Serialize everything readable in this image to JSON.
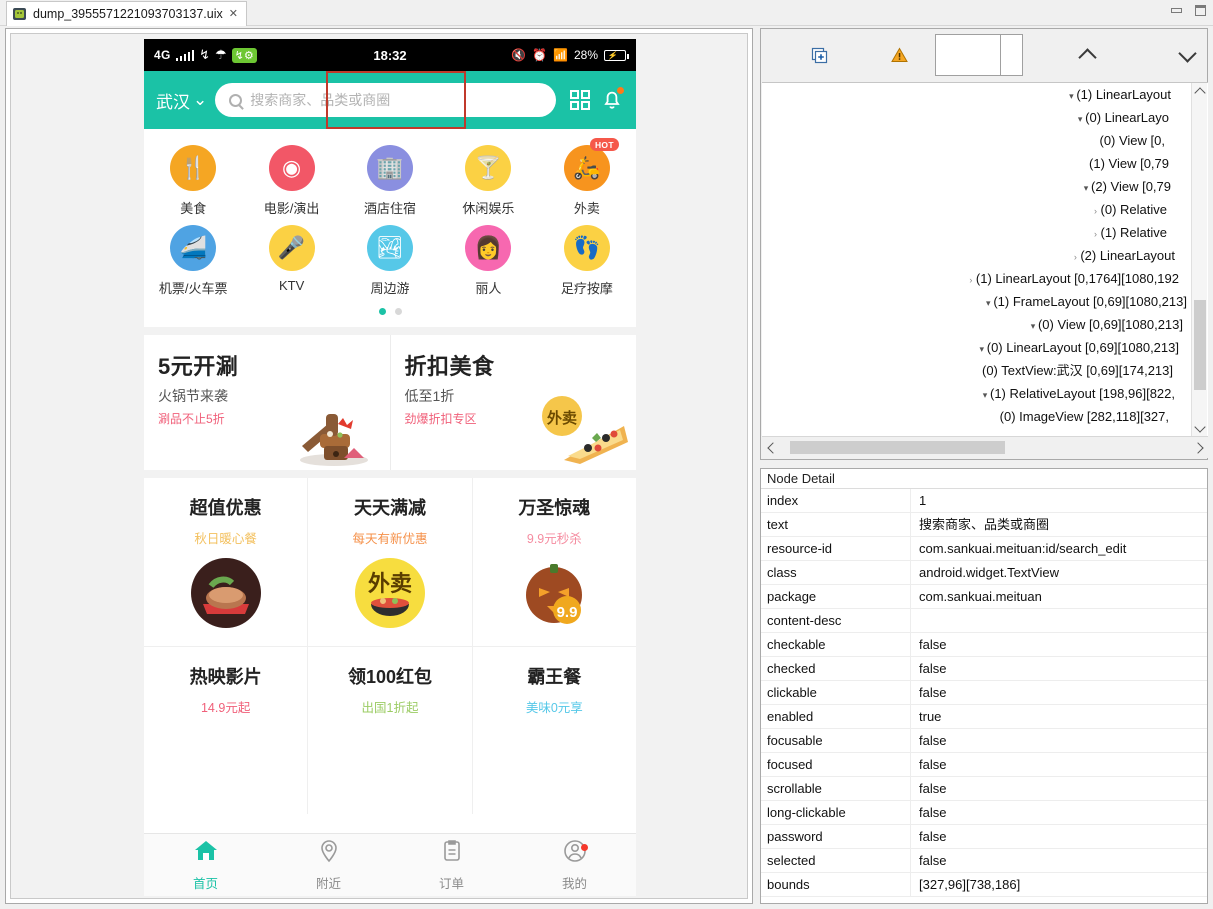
{
  "window": {
    "tab_title": "dump_3955571221093703137.uix",
    "tab_close": "✕",
    "minimize": "minimize-button",
    "maximize": "maximize-button"
  },
  "phone": {
    "status_bar": {
      "network": "4G",
      "time": "18:32",
      "battery_percent": "28%",
      "icons": [
        "signal-bars-icon",
        "usb-icon",
        "wifi-tether-icon",
        "usb-debug-icon",
        "mute-icon",
        "alarm-icon",
        "wifi-icon",
        "battery-charging-icon"
      ]
    },
    "header": {
      "city": "武汉",
      "city_chevron": "⌄",
      "search_placeholder": "搜索商家、品类或商圈",
      "search_value": "",
      "qr_icon": "qr-scan-icon",
      "bell_icon": "notification-bell-icon"
    },
    "categories_row1": [
      {
        "label": "美食",
        "icon": "food-icon",
        "glyph": "🍴",
        "color": "#f5a623",
        "badge": ""
      },
      {
        "label": "电影/演出",
        "icon": "movie-icon",
        "glyph": "◉",
        "color": "#f25767",
        "badge": ""
      },
      {
        "label": "酒店住宿",
        "icon": "hotel-icon",
        "glyph": "🏢",
        "color": "#8a8fe0",
        "badge": ""
      },
      {
        "label": "休闲娱乐",
        "icon": "entertainment-icon",
        "glyph": "🍸",
        "color": "#fbd144",
        "badge": ""
      },
      {
        "label": "外卖",
        "icon": "takeout-icon",
        "glyph": "🛵",
        "color": "#f7941e",
        "badge": "HOT"
      }
    ],
    "categories_row2": [
      {
        "label": "机票/火车票",
        "icon": "travel-ticket-icon",
        "glyph": "🚄",
        "color": "#4fa3e3",
        "badge": ""
      },
      {
        "label": "KTV",
        "icon": "ktv-icon",
        "glyph": "🎤",
        "color": "#fbd144",
        "badge": ""
      },
      {
        "label": "周边游",
        "icon": "nearby-trip-icon",
        "glyph": "🏞",
        "color": "#56c8e8",
        "badge": ""
      },
      {
        "label": "丽人",
        "icon": "beauty-icon",
        "glyph": "👩",
        "color": "#f768b0",
        "badge": ""
      },
      {
        "label": "足疗按摩",
        "icon": "massage-icon",
        "glyph": "👣",
        "color": "#fbd144",
        "badge": ""
      }
    ],
    "pager": {
      "active_color": "#1bc2a6",
      "inactive_color": "#d8d8d8",
      "count": 2,
      "active_index": 0
    },
    "banners": [
      {
        "title": "5元开涮",
        "sub": "火锅节来袭",
        "tag": "涮品不止5折",
        "art": "hotpot-image"
      },
      {
        "title": "折扣美食",
        "sub": "低至1折",
        "tag": "劲爆折扣专区",
        "art": "pizza-image"
      }
    ],
    "promos_row1": [
      {
        "title": "超值优惠",
        "sub": "秋日暖心餐",
        "sub_color": "#f3c05e",
        "art": "steak-image"
      },
      {
        "title": "天天满减",
        "sub": "每天有新优惠",
        "sub_color": "#f5914a",
        "art": "takeout-bowl-image"
      },
      {
        "title": "万圣惊魂",
        "sub": "9.9元秒杀",
        "sub_color": "#f58ca0",
        "art": "pumpkin-image"
      }
    ],
    "promos_row2": [
      {
        "title": "热映影片",
        "sub": "14.9元起",
        "sub_color": "#f0607a",
        "art": ""
      },
      {
        "title": "领100红包",
        "sub": "出国1折起",
        "sub_color": "#9ccc65",
        "art": ""
      },
      {
        "title": "霸王餐",
        "sub": "美味0元享",
        "sub_color": "#56c8e8",
        "art": ""
      }
    ],
    "bottom_nav": [
      {
        "label": "首页",
        "icon": "home-icon",
        "active": true,
        "dot": false
      },
      {
        "label": "附近",
        "icon": "location-pin-icon",
        "active": false,
        "dot": false
      },
      {
        "label": "订单",
        "icon": "orders-clipboard-icon",
        "active": false,
        "dot": false
      },
      {
        "label": "我的",
        "icon": "profile-person-icon",
        "active": false,
        "dot": true
      }
    ],
    "accent_color": "#1bc2a6",
    "selection_color": "#c0392b"
  },
  "tree_toolbar": {
    "expand_icon": "expand-all-icon",
    "warning_icon": "warning-icon",
    "filter_value": "",
    "up_icon": "chevron-up-icon",
    "down_icon": "chevron-down-icon"
  },
  "tree": {
    "nodes": [
      {
        "indent": 16,
        "tri": "open",
        "text": "(1) LinearLayout"
      },
      {
        "indent": 18,
        "tri": "open",
        "text": "(0) LinearLayo"
      },
      {
        "indent": 22,
        "tri": "none",
        "text": "(0) View [0,"
      },
      {
        "indent": 18,
        "tri": "none",
        "text": "(1) View [0,79"
      },
      {
        "indent": 16,
        "tri": "open",
        "text": "(2) View [0,79"
      },
      {
        "indent": 20,
        "tri": "closed",
        "text": "(0) Relative"
      },
      {
        "indent": 20,
        "tri": "closed",
        "text": "(1) Relative"
      },
      {
        "indent": 12,
        "tri": "closed",
        "text": "(2) LinearLayout"
      },
      {
        "indent": 8,
        "tri": "closed",
        "text": "(1) LinearLayout [0,1764][1080,192"
      },
      {
        "indent": 0,
        "tri": "open",
        "text": "(1) FrameLayout [0,69][1080,213]"
      },
      {
        "indent": 4,
        "tri": "open",
        "text": "(0) View [0,69][1080,213]"
      },
      {
        "indent": 8,
        "tri": "open",
        "text": "(0) LinearLayout [0,69][1080,213]"
      },
      {
        "indent": 14,
        "tri": "none",
        "text": "(0) TextView:武汉 [0,69][174,213]"
      },
      {
        "indent": 12,
        "tri": "open",
        "text": "(1) RelativeLayout [198,96][822,"
      },
      {
        "indent": 18,
        "tri": "none",
        "text": "(0) ImageView [282,118][327,"
      }
    ]
  },
  "node_detail": {
    "title": "Node Detail",
    "rows": [
      {
        "key": "index",
        "value": "1"
      },
      {
        "key": "text",
        "value": "搜索商家、品类或商圈"
      },
      {
        "key": "resource-id",
        "value": "com.sankuai.meituan:id/search_edit"
      },
      {
        "key": "class",
        "value": "android.widget.TextView"
      },
      {
        "key": "package",
        "value": "com.sankuai.meituan"
      },
      {
        "key": "content-desc",
        "value": ""
      },
      {
        "key": "checkable",
        "value": "false"
      },
      {
        "key": "checked",
        "value": "false"
      },
      {
        "key": "clickable",
        "value": "false"
      },
      {
        "key": "enabled",
        "value": "true"
      },
      {
        "key": "focusable",
        "value": "false"
      },
      {
        "key": "focused",
        "value": "false"
      },
      {
        "key": "scrollable",
        "value": "false"
      },
      {
        "key": "long-clickable",
        "value": "false"
      },
      {
        "key": "password",
        "value": "false"
      },
      {
        "key": "selected",
        "value": "false"
      },
      {
        "key": "bounds",
        "value": "[327,96][738,186]"
      }
    ]
  }
}
